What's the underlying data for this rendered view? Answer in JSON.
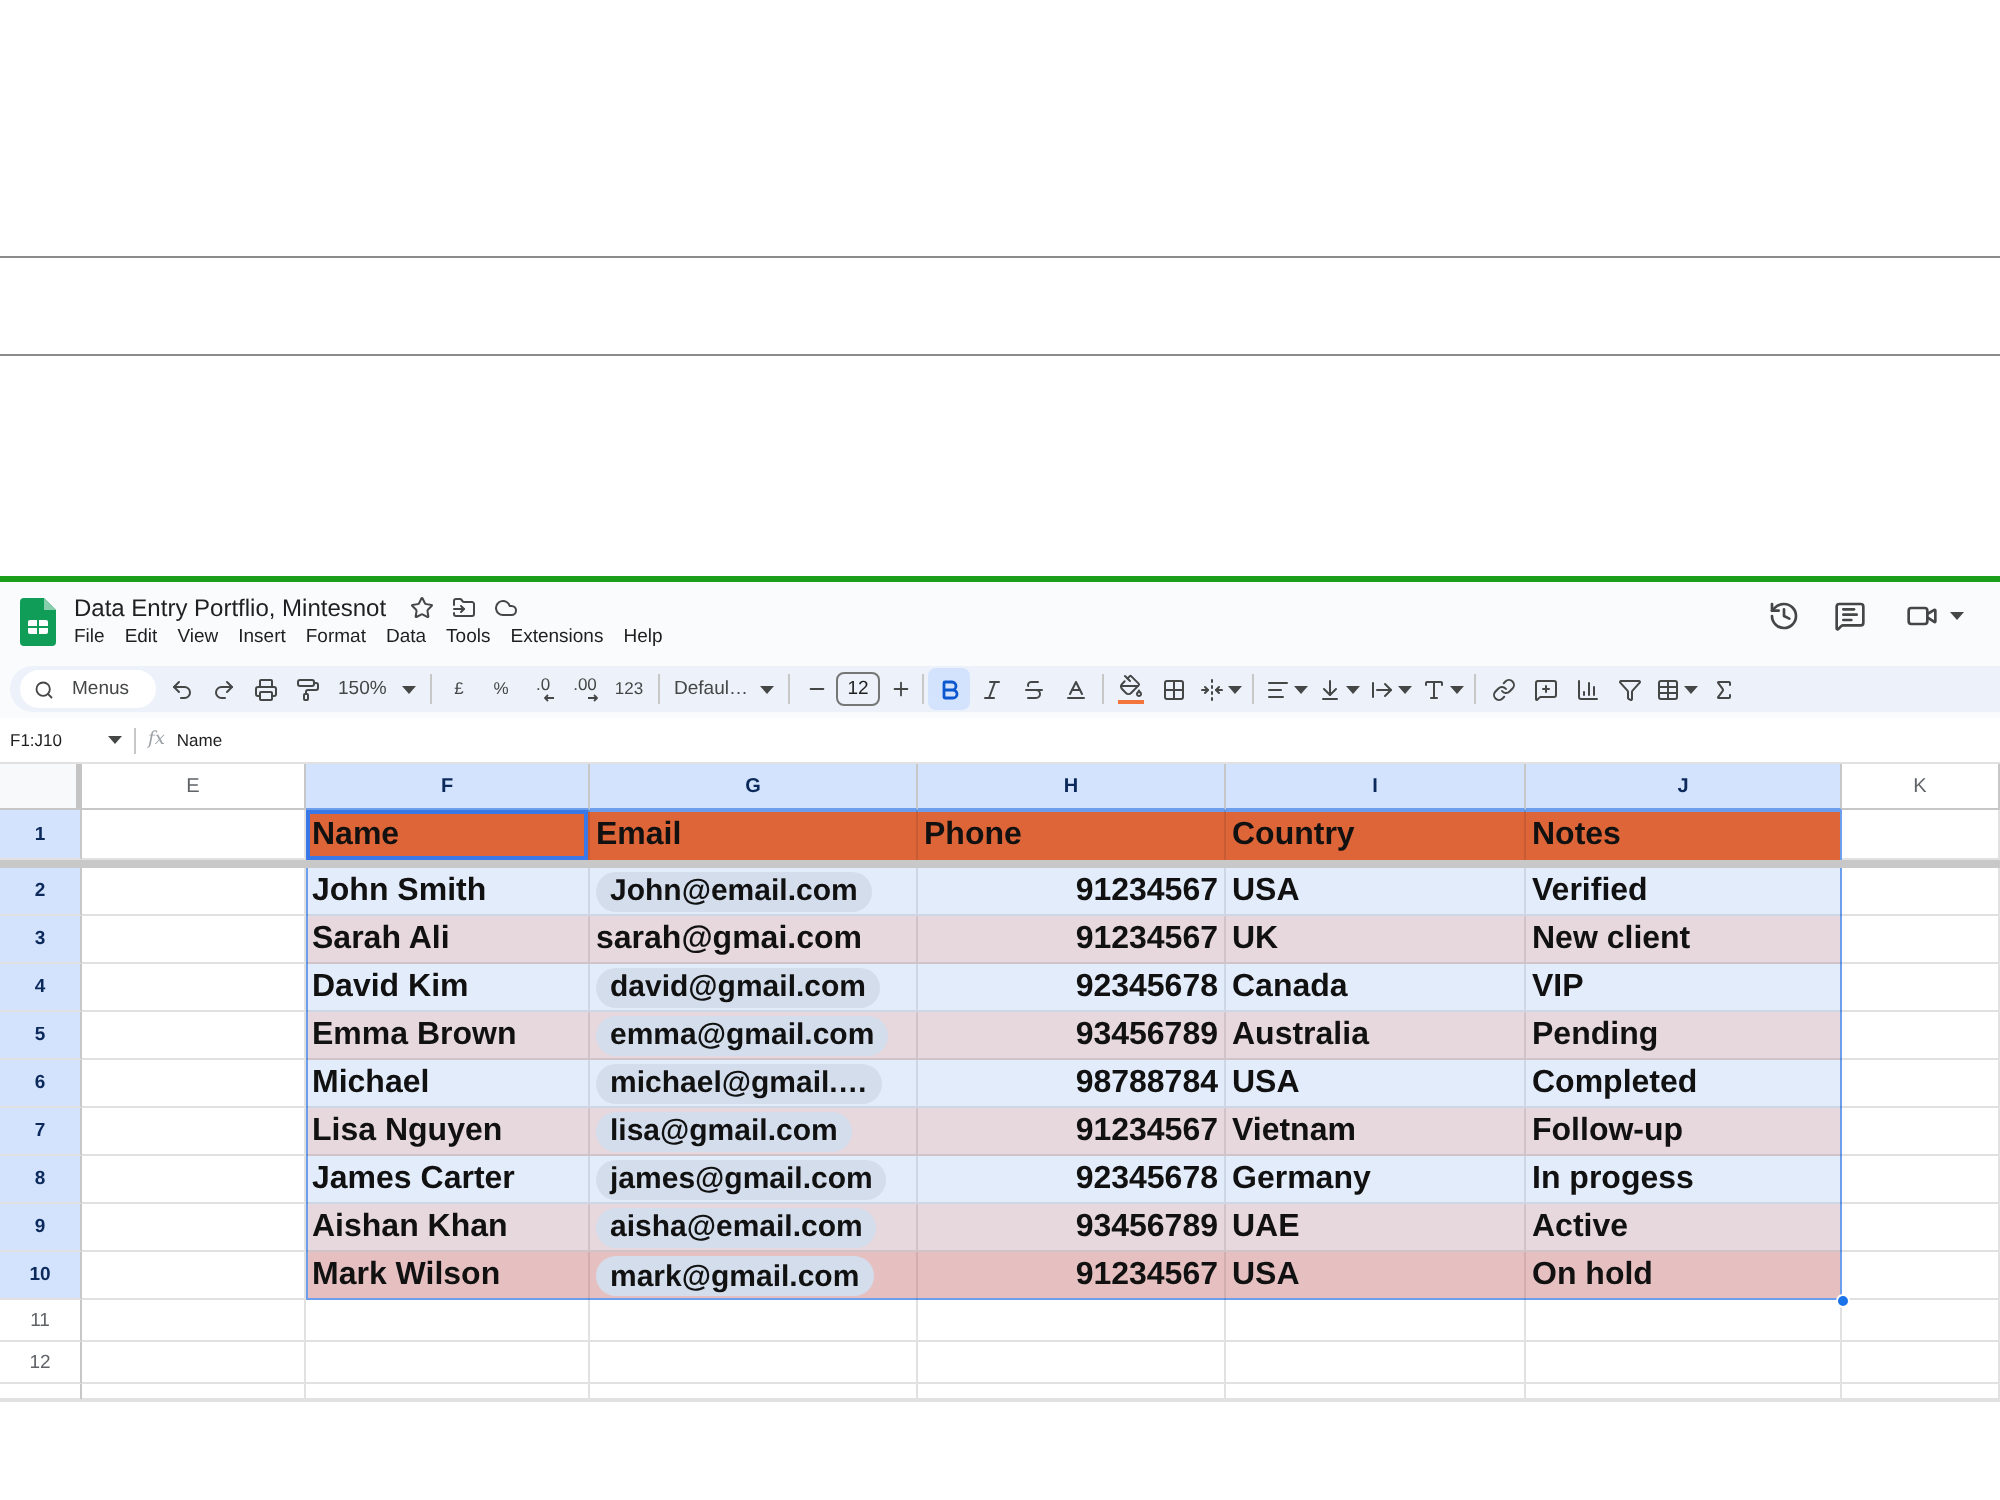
{
  "document": {
    "title": "Data Entry Portflio, Mintesnot",
    "menus": [
      "File",
      "Edit",
      "View",
      "Insert",
      "Format",
      "Data",
      "Tools",
      "Extensions",
      "Help"
    ]
  },
  "toolbar": {
    "search": {
      "placeholder": "Menus"
    },
    "zoom": "150%",
    "number_formats": [
      {
        "kind": "currency",
        "label": "£"
      },
      {
        "kind": "percent",
        "label": "%"
      },
      {
        "kind": "decrease_decimals",
        "label": ".0"
      },
      {
        "kind": "increase_decimals",
        "label": ".00"
      },
      {
        "kind": "more_formats",
        "label": "123"
      }
    ],
    "font": "Defaul…",
    "font_size": "12",
    "text_styles": [
      {
        "kind": "bold",
        "on": true
      },
      {
        "kind": "italic",
        "on": false
      },
      {
        "kind": "strikethrough",
        "on": false
      }
    ]
  },
  "formula_bar": {
    "name_box": "F1:J10",
    "function_label": "fx",
    "formula": "Name"
  },
  "sheet": {
    "columns": [
      {
        "label": "E",
        "selected": false
      },
      {
        "label": "F",
        "selected": true
      },
      {
        "label": "G",
        "selected": true
      },
      {
        "label": "H",
        "selected": true
      },
      {
        "label": "I",
        "selected": true
      },
      {
        "label": "J",
        "selected": true
      },
      {
        "label": "K",
        "selected": false
      }
    ],
    "header_row": {
      "number": "1",
      "selected": true,
      "cells": [
        {
          "text": "Name",
          "active": true
        },
        {
          "text": "Email",
          "active": false
        },
        {
          "text": "Phone",
          "active": false
        },
        {
          "text": "Country",
          "active": false
        },
        {
          "text": "Notes",
          "active": false
        }
      ]
    },
    "rows": [
      {
        "number": "2",
        "selected": true,
        "color": "#e3ecfb",
        "name": "John Smith",
        "email": {
          "text": "John@email.com",
          "chip": true
        },
        "phone": "91234567",
        "country": "USA",
        "notes": "Verified"
      },
      {
        "number": "3",
        "selected": true,
        "color": "#e6d8dc",
        "name": "Sarah Ali",
        "email": {
          "text": "sarah@gmai.com",
          "chip": false
        },
        "phone": "91234567",
        "country": "UK",
        "notes": "New client"
      },
      {
        "number": "4",
        "selected": true,
        "color": "#e3ecfb",
        "name": "David Kim",
        "email": {
          "text": "david@gmail.com",
          "chip": true
        },
        "phone": "92345678",
        "country": "Canada",
        "notes": "VIP"
      },
      {
        "number": "5",
        "selected": true,
        "color": "#e6d8dc",
        "name": "Emma Brown",
        "email": {
          "text": "emma@gmail.com",
          "chip": true
        },
        "phone": "93456789",
        "country": "Australia",
        "notes": "Pending"
      },
      {
        "number": "6",
        "selected": true,
        "color": "#e3ecfb",
        "name": "Michael",
        "email": {
          "text": "michael@gmail.…",
          "chip": true
        },
        "phone": "98788784",
        "country": "USA",
        "notes": "Completed"
      },
      {
        "number": "7",
        "selected": true,
        "color": "#e6d8dc",
        "name": "Lisa Nguyen",
        "email": {
          "text": "lisa@gmail.com",
          "chip": true
        },
        "phone": "91234567",
        "country": "Vietnam",
        "notes": "Follow-up"
      },
      {
        "number": "8",
        "selected": true,
        "color": "#e3ecfb",
        "name": "James Carter",
        "email": {
          "text": "james@gmail.com",
          "chip": true
        },
        "phone": "92345678",
        "country": "Germany",
        "notes": "In progess"
      },
      {
        "number": "9",
        "selected": true,
        "color": "#e6d8dc",
        "name": "Aishan Khan",
        "email": {
          "text": "aisha@email.com",
          "chip": true
        },
        "phone": "93456789",
        "country": "UAE",
        "notes": "Active"
      },
      {
        "number": "10",
        "selected": true,
        "color": "#e6c0c1",
        "name": "Mark Wilson",
        "email": {
          "text": "mark@gmail.com",
          "chip": true
        },
        "phone": "91234567",
        "country": "USA",
        "notes": "On hold"
      }
    ],
    "empty_rows": [
      {
        "number": "11",
        "selected": false
      },
      {
        "number": "12",
        "selected": false
      }
    ]
  }
}
